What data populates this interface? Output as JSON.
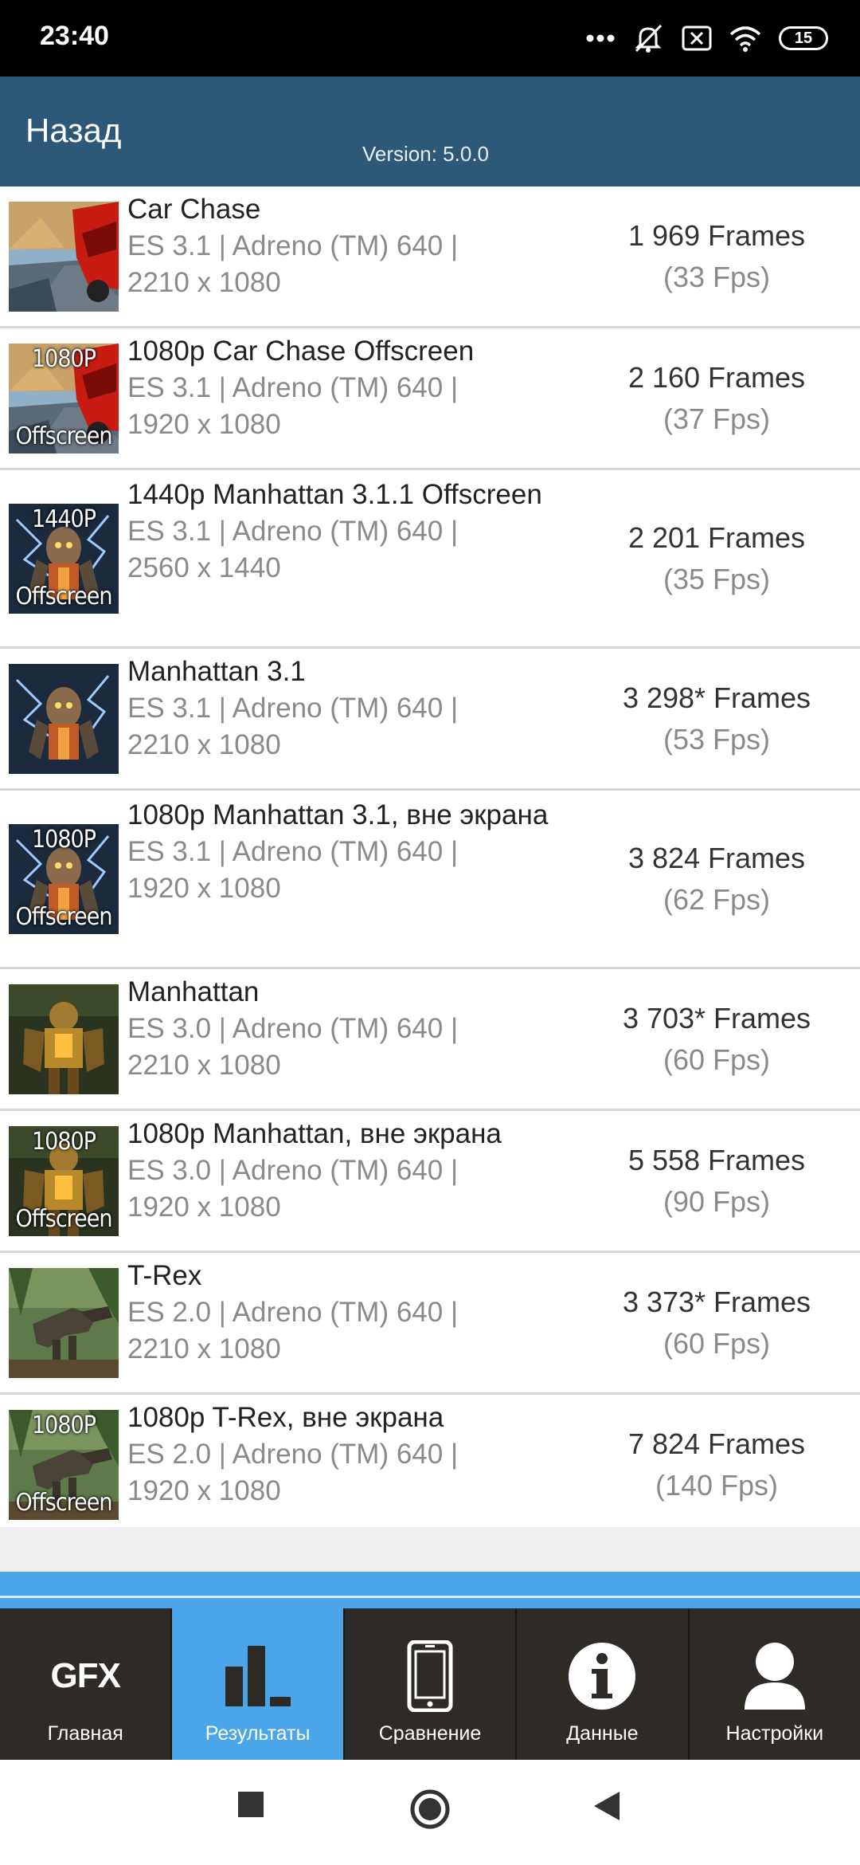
{
  "status_bar": {
    "time": "23:40",
    "battery": "15"
  },
  "header": {
    "back_label": "Назад",
    "version": "Version: 5.0.0"
  },
  "results": [
    {
      "title": "Car Chase",
      "api": "ES 3.1 | Adreno (TM) 640 |",
      "resolution": "2210 x 1080",
      "frames": "1 969 Frames",
      "fps": "(33 Fps)",
      "thumb": "car",
      "tag": ""
    },
    {
      "title": "1080p Car Chase Offscreen",
      "api": "ES 3.1 | Adreno (TM) 640 |",
      "resolution": "1920 x 1080",
      "frames": "2 160 Frames",
      "fps": "(37 Fps)",
      "thumb": "car",
      "tag": "1080P"
    },
    {
      "title": "1440p Manhattan 3.1.1 Offscreen",
      "api": "ES 3.1 | Adreno (TM) 640 |",
      "resolution": "2560 x 1440",
      "frames": "2 201 Frames",
      "fps": "(35 Fps)",
      "thumb": "robot",
      "tag": "1440P"
    },
    {
      "title": "Manhattan 3.1",
      "api": "ES 3.1 | Adreno (TM) 640 |",
      "resolution": "2210 x 1080",
      "frames": "3 298* Frames",
      "fps": "(53 Fps)",
      "thumb": "robot",
      "tag": ""
    },
    {
      "title": "1080p Manhattan 3.1, вне экрана",
      "api": "ES 3.1 | Adreno (TM) 640 |",
      "resolution": "1920 x 1080",
      "frames": "3 824 Frames",
      "fps": "(62 Fps)",
      "thumb": "robot",
      "tag": "1080P"
    },
    {
      "title": "Manhattan",
      "api": "ES 3.0 | Adreno (TM) 640 |",
      "resolution": "2210 x 1080",
      "frames": "3 703* Frames",
      "fps": "(60 Fps)",
      "thumb": "mech",
      "tag": ""
    },
    {
      "title": "1080p Manhattan, вне экрана",
      "api": "ES 3.0 | Adreno (TM) 640 |",
      "resolution": "1920 x 1080",
      "frames": "5 558 Frames",
      "fps": "(90 Fps)",
      "thumb": "mech",
      "tag": "1080P"
    },
    {
      "title": "T-Rex",
      "api": "ES 2.0 | Adreno (TM) 640 |",
      "resolution": "2210 x 1080",
      "frames": "3 373* Frames",
      "fps": "(60 Fps)",
      "thumb": "trex",
      "tag": ""
    },
    {
      "title": "1080p T-Rex, вне экрана",
      "api": "ES 2.0 | Adreno (TM) 640 |",
      "resolution": "1920 x 1080",
      "frames": "7 824 Frames",
      "fps": "(140 Fps)",
      "thumb": "trex",
      "tag": "1080P"
    }
  ],
  "thumb_bottom_tag": "Offscreen",
  "bottom_nav": {
    "gfx_logo": "GFX",
    "items": [
      {
        "label": "Главная",
        "icon": "gfx-logo-icon",
        "active": false
      },
      {
        "label": "Результаты",
        "icon": "bar-chart-icon",
        "active": true
      },
      {
        "label": "Сравнение",
        "icon": "phone-icon",
        "active": false
      },
      {
        "label": "Данные",
        "icon": "info-icon",
        "active": false
      },
      {
        "label": "Настройки",
        "icon": "user-icon",
        "active": false
      }
    ]
  },
  "colors": {
    "header": "#2d5877",
    "accent": "#4aa6e8",
    "nav_bg": "#2e2a26"
  }
}
